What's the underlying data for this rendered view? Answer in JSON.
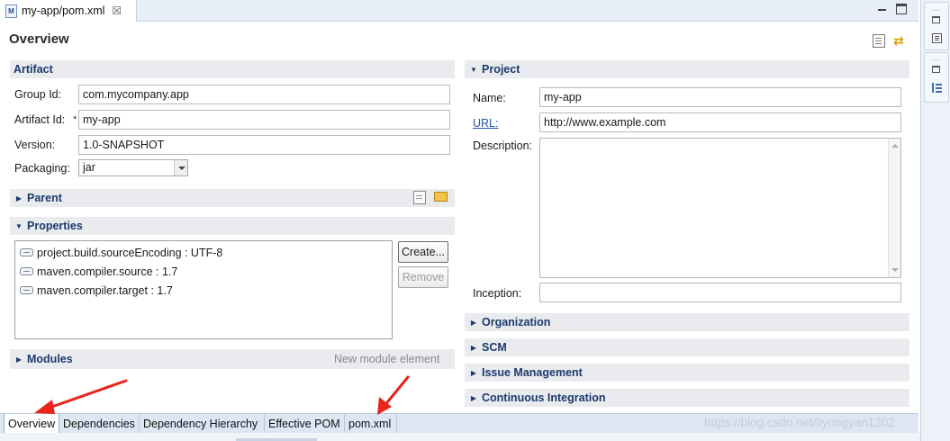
{
  "editor_tab": {
    "title": "my-app/pom.xml",
    "close": "☒",
    "icon_label": "M"
  },
  "page_title": "Overview",
  "artifact": {
    "title": "Artifact",
    "group_id_label": "Group Id:",
    "group_id_value": "com.mycompany.app",
    "artifact_id_label": "Artifact Id:",
    "artifact_id_required": "*",
    "artifact_id_value": "my-app",
    "version_label": "Version:",
    "version_value": "1.0-SNAPSHOT",
    "packaging_label": "Packaging:",
    "packaging_value": "jar"
  },
  "parent": {
    "title": "Parent"
  },
  "properties": {
    "title": "Properties",
    "items": [
      "project.build.sourceEncoding : UTF-8",
      "maven.compiler.source : 1.7",
      "maven.compiler.target : 1.7"
    ],
    "create_label": "Create...",
    "remove_label": "Remove"
  },
  "modules": {
    "title": "Modules",
    "hint": "New module element"
  },
  "project": {
    "title": "Project",
    "name_label": "Name:",
    "name_value": "my-app",
    "url_label": "URL:",
    "url_value": "http://www.example.com",
    "description_label": "Description:",
    "description_value": "",
    "inception_label": "Inception:",
    "inception_value": ""
  },
  "collapsed_sections": [
    "Organization",
    "SCM",
    "Issue Management",
    "Continuous Integration"
  ],
  "page_tabs": [
    "Overview",
    "Dependencies",
    "Dependency Hierarchy",
    "Effective POM",
    "pom.xml"
  ],
  "active_page_tab": "Overview",
  "watermark": "https://blog.csdn.net/liyongyan1202",
  "colors": {
    "section_title": "#1c3a6c",
    "link": "#2357a6",
    "annotation_arrow": "#e8241c"
  }
}
